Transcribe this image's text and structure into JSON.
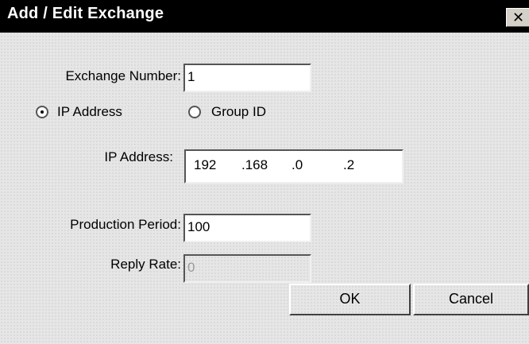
{
  "window": {
    "title": "Add / Edit Exchange",
    "close_glyph": "✕"
  },
  "form": {
    "exchange_number": {
      "label": "Exchange Number:",
      "value": "1"
    },
    "address_type": {
      "options": [
        {
          "label": "IP Address",
          "selected": true
        },
        {
          "label": "Group ID",
          "selected": false
        }
      ]
    },
    "ip_address": {
      "label": "IP Address:",
      "segments": [
        "192",
        ".168",
        ".0",
        ".2"
      ]
    },
    "production_period": {
      "label": "Production Period:",
      "value": "100"
    },
    "reply_rate": {
      "label": "Reply Rate:",
      "value": "0",
      "disabled": true
    }
  },
  "buttons": {
    "ok_label": "OK",
    "cancel_label": "Cancel"
  },
  "icons": {
    "close": "close-icon",
    "radio_selected": "radio-selected-icon",
    "radio_unselected": "radio-unselected-icon"
  }
}
